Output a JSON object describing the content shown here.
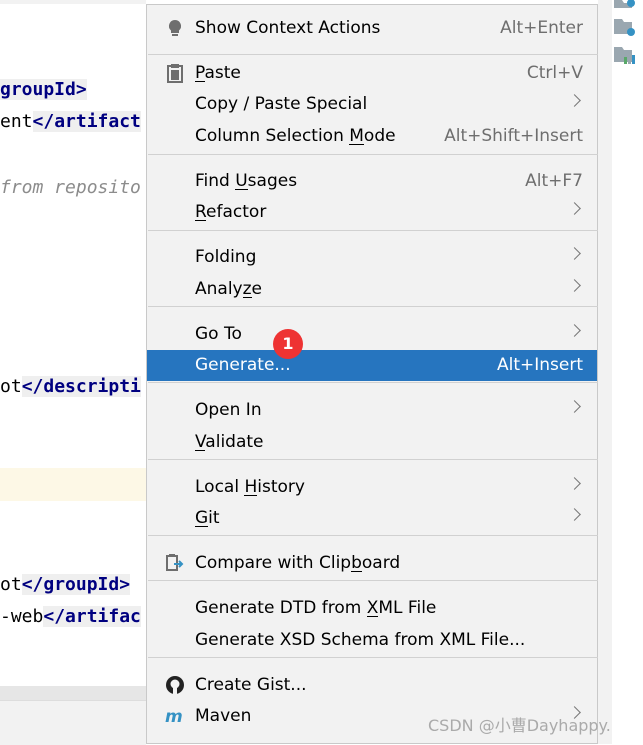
{
  "editor": {
    "lines": [
      {
        "parts": [
          {
            "t": "groupId>",
            "c": "tag hl"
          }
        ]
      },
      {
        "parts": [
          {
            "t": "ent",
            "c": ""
          },
          {
            "t": "</artifact",
            "c": "tag hl"
          }
        ]
      },
      {
        "parts": [
          {
            "t": "from reposito",
            "c": "cmt"
          }
        ]
      },
      {
        "parts": [
          {
            "t": "ot",
            "c": ""
          },
          {
            "t": "</descripti",
            "c": "tag hl"
          }
        ]
      },
      {
        "parts": [
          {
            "t": "ot",
            "c": ""
          },
          {
            "t": "</groupId>",
            "c": "tag hl"
          }
        ]
      },
      {
        "parts": [
          {
            "t": "-web",
            "c": ""
          },
          {
            "t": "</artifac",
            "c": "tag hl"
          }
        ]
      }
    ]
  },
  "menu": {
    "items": [
      {
        "label": "Show Context Actions",
        "shortcut": "Alt+Enter",
        "icon": "lightbulb-icon"
      },
      {
        "label": "Paste",
        "mn": "P",
        "shortcut": "Ctrl+V",
        "icon": "clipboard-icon"
      },
      {
        "label": "Copy / Paste Special",
        "submenu": true
      },
      {
        "label": "Column Selection Mode",
        "mn": "M",
        "shortcut": "Alt+Shift+Insert"
      },
      {
        "label": "Find Usages",
        "mn": "U",
        "shortcut": "Alt+F7"
      },
      {
        "label": "Refactor",
        "mn": "R",
        "submenu": true
      },
      {
        "label": "Folding",
        "submenu": true
      },
      {
        "label": "Analyze",
        "mn": "z",
        "submenu": true
      },
      {
        "label": "Go To",
        "submenu": true
      },
      {
        "label": "Generate...",
        "shortcut": "Alt+Insert",
        "selected": true
      },
      {
        "label": "Open In",
        "submenu": true
      },
      {
        "label": "Validate",
        "mn": "V"
      },
      {
        "label": "Local History",
        "mn": "H",
        "submenu": true
      },
      {
        "label": "Git",
        "mn": "G",
        "submenu": true
      },
      {
        "label": "Compare with Clipboard",
        "mn": "b",
        "icon": "compare-clipboard-icon"
      },
      {
        "label": "Generate DTD from XML File",
        "mn": "X"
      },
      {
        "label": "Generate XSD Schema from XML File..."
      },
      {
        "label": "Create Gist...",
        "icon": "github-icon"
      },
      {
        "label": "Maven",
        "icon": "maven-icon",
        "submenu": true
      }
    ]
  },
  "badge": "1",
  "watermark": "CSDN @小曹Dayhappy.",
  "colors": {
    "selection": "#2675bf",
    "badge": "#e33333",
    "tag": "#000080"
  }
}
